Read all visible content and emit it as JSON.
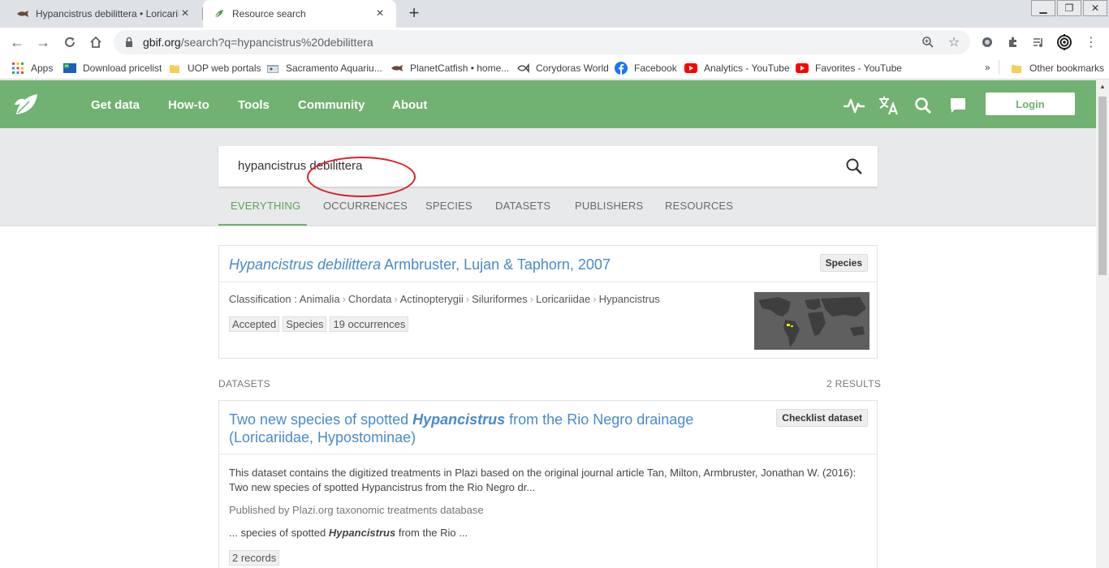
{
  "browser": {
    "tabs": [
      {
        "title": "Hypancistrus debilittera • Loricariidae",
        "icon": "catfish-icon"
      },
      {
        "title": "Resource search",
        "icon": "gbif-leaf-icon"
      }
    ],
    "url_host": "gbif.org",
    "url_path": "/search?q=hypancistrus%20debilittera",
    "bookmarks": [
      {
        "label": "Apps",
        "icon": "apps-grid-icon"
      },
      {
        "label": "Download pricelist",
        "icon": "flag-icon"
      },
      {
        "label": "UOP web portals",
        "icon": "folder-icon"
      },
      {
        "label": "Sacramento Aquariu...",
        "icon": "aquarium-icon"
      },
      {
        "label": "PlanetCatfish • home...",
        "icon": "catfish-icon"
      },
      {
        "label": "Corydoras World",
        "icon": "fish-icon"
      },
      {
        "label": "Facebook",
        "icon": "facebook-icon"
      },
      {
        "label": "Analytics - YouTube",
        "icon": "youtube-icon"
      },
      {
        "label": "Favorites - YouTube",
        "icon": "youtube-icon"
      }
    ],
    "bookmarks_more": "»",
    "other_bookmarks": "Other bookmarks"
  },
  "site": {
    "nav": [
      "Get data",
      "How-to",
      "Tools",
      "Community",
      "About"
    ],
    "login": "Login"
  },
  "search": {
    "query": "hypancistrus debilittera",
    "tabs": [
      "EVERYTHING",
      "OCCURRENCES",
      "SPECIES",
      "DATASETS",
      "PUBLISHERS",
      "RESOURCES"
    ],
    "active_tab": "EVERYTHING",
    "highlighted_tab": "OCCURRENCES"
  },
  "species_card": {
    "name": "Hypancistrus debilittera",
    "authority": "Armbruster, Lujan & Taphorn, 2007",
    "badge": "Species",
    "classification_label": "Classification :",
    "classification": [
      "Animalia",
      "Chordata",
      "Actinopterygii",
      "Siluriformes",
      "Loricariidae",
      "Hypancistrus"
    ],
    "tags": [
      "Accepted",
      "Species",
      "19 occurrences"
    ]
  },
  "datasets_section": {
    "label": "DATASETS",
    "count": "2 RESULTS"
  },
  "dataset_card": {
    "title_pre": "Two new species of spotted ",
    "title_em": "Hypancistrus",
    "title_post": " from the Rio Negro drainage (Loricariidae, Hypostominae)",
    "badge": "Checklist dataset",
    "description": "This dataset contains the digitized treatments in Plazi based on the original journal article Tan, Milton, Armbruster, Jonathan W. (2016): Two new species of spotted Hypancistrus from the Rio Negro dr...",
    "publisher": "Published by Plazi.org taxonomic treatments database",
    "snippet_pre": "... species of spotted ",
    "snippet_em": "Hypancistrus",
    "snippet_post": " from the Rio ...",
    "records": "2 records"
  },
  "colors": {
    "brand_green": "#71b171",
    "link_blue": "#4a8ac9",
    "annotation_red": "#d8202a"
  }
}
